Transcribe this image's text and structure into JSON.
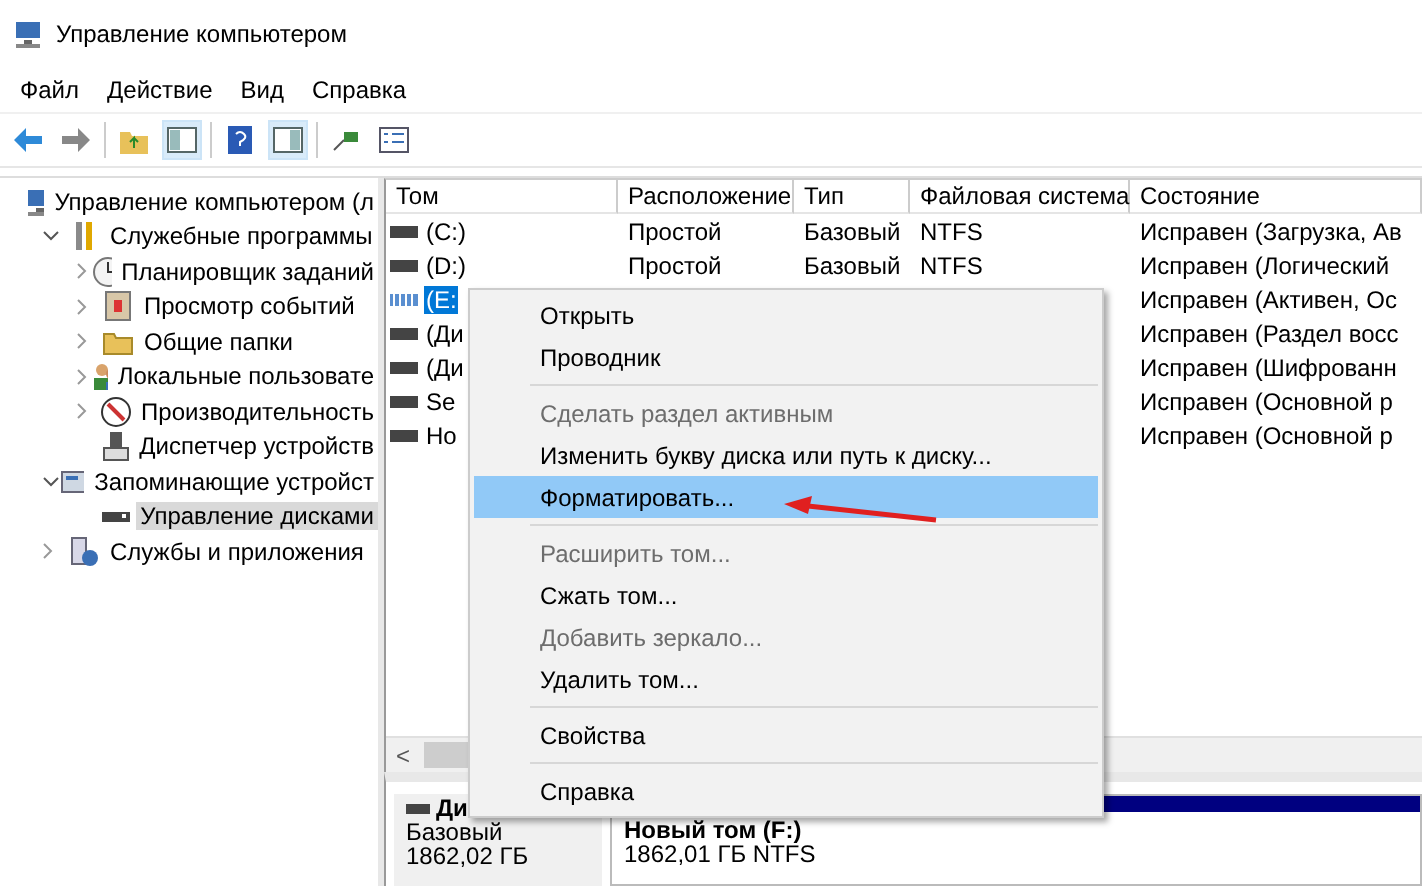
{
  "window": {
    "title": "Управление компьютером"
  },
  "menu": [
    "Файл",
    "Действие",
    "Вид",
    "Справка"
  ],
  "toolbar": [
    {
      "kind": "back",
      "pressed": false
    },
    {
      "kind": "forward",
      "pressed": false
    },
    {
      "kind": "up",
      "pressed": false
    },
    {
      "kind": "tree",
      "pressed": true
    },
    {
      "kind": "help",
      "pressed": false
    },
    {
      "kind": "pane",
      "pressed": true
    },
    {
      "kind": "connect",
      "pressed": false
    },
    {
      "kind": "props",
      "pressed": false
    }
  ],
  "tree": [
    {
      "label": "Управление компьютером (л",
      "selected": false,
      "children": [
        {
          "label": "Служебные программы",
          "expanded": true,
          "selected": false,
          "children": [
            {
              "label": "Планировщик заданий",
              "expanded": false,
              "selected": false
            },
            {
              "label": "Просмотр событий",
              "expanded": false,
              "selected": false
            },
            {
              "label": "Общие папки",
              "expanded": false,
              "selected": false
            },
            {
              "label": "Локальные пользовате",
              "expanded": false,
              "selected": false
            },
            {
              "label": "Производительность",
              "expanded": false,
              "selected": false
            },
            {
              "label": "Диспетчер устройств",
              "selected": false
            }
          ]
        },
        {
          "label": "Запоминающие устройст",
          "expanded": true,
          "selected": false,
          "children": [
            {
              "label": "Управление дисками",
              "selected": true
            }
          ]
        },
        {
          "label": "Службы и приложения",
          "expanded": false,
          "selected": false
        }
      ]
    }
  ],
  "table": {
    "columns": [
      "Том",
      "Расположение",
      "Тип",
      "Файловая система",
      "Состояние"
    ],
    "rows": [
      {
        "cells": [
          "(C:)",
          "Простой",
          "Базовый",
          "NTFS",
          "Исправен (Загрузка, Ав"
        ],
        "selected": false,
        "kind": "disk"
      },
      {
        "cells": [
          "(D:)",
          "Простой",
          "Базовый",
          "NTFS",
          "Исправен (Логический"
        ],
        "selected": false,
        "kind": "disk"
      },
      {
        "cells": [
          "(E:",
          "",
          "",
          "",
          "Исправен (Активен, Ос"
        ],
        "selected": true,
        "kind": "striped"
      },
      {
        "cells": [
          "(Ди",
          "",
          "",
          "",
          "Исправен (Раздел восс"
        ],
        "selected": false,
        "kind": "disk"
      },
      {
        "cells": [
          "(Ди",
          "",
          "",
          "",
          "Исправен (Шифрованн"
        ],
        "selected": false,
        "kind": "disk"
      },
      {
        "cells": [
          "Se",
          "",
          "",
          "",
          "Исправен (Основной р"
        ],
        "selected": false,
        "kind": "disk"
      },
      {
        "cells": [
          "Ho",
          "",
          "",
          "",
          "Исправен (Основной р"
        ],
        "selected": false,
        "kind": "disk"
      }
    ]
  },
  "context_menu": [
    {
      "kind": "item",
      "label": "Открыть",
      "disabled": false,
      "selected": false
    },
    {
      "kind": "item",
      "label": "Проводник",
      "disabled": false,
      "selected": false
    },
    {
      "kind": "separator"
    },
    {
      "kind": "item",
      "label": "Сделать раздел активным",
      "disabled": true,
      "selected": false
    },
    {
      "kind": "item",
      "label": "Изменить букву диска или путь к диску...",
      "disabled": false,
      "selected": false
    },
    {
      "kind": "item",
      "label": "Форматировать...",
      "disabled": false,
      "selected": true
    },
    {
      "kind": "separator"
    },
    {
      "kind": "item",
      "label": "Расширить том...",
      "disabled": true,
      "selected": false
    },
    {
      "kind": "item",
      "label": "Сжать том...",
      "disabled": false,
      "selected": false
    },
    {
      "kind": "item",
      "label": "Добавить зеркало...",
      "disabled": true,
      "selected": false
    },
    {
      "kind": "item",
      "label": "Удалить том...",
      "disabled": false,
      "selected": false
    },
    {
      "kind": "separator"
    },
    {
      "kind": "item",
      "label": "Свойства",
      "disabled": false,
      "selected": false
    },
    {
      "kind": "separator"
    },
    {
      "kind": "item",
      "label": "Справка",
      "disabled": false,
      "selected": false
    }
  ],
  "scrollbar": {
    "left": "<"
  },
  "disk_map": {
    "disk": {
      "name": "Ди",
      "type": "Базовый",
      "size": "1862,02 ГБ"
    },
    "volume": {
      "name": "Новый том  (F:)",
      "info": "1862,01 ГБ NTFS"
    }
  }
}
